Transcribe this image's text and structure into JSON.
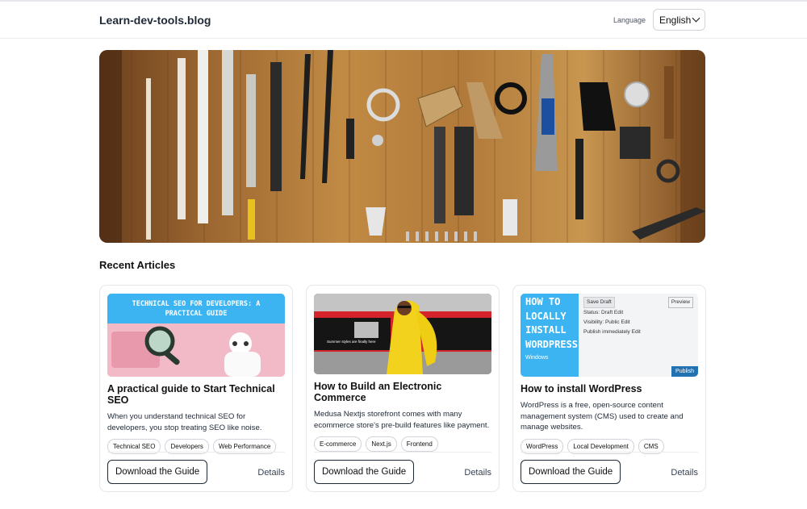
{
  "header": {
    "brand": "Learn-dev-tools.blog",
    "language_label": "Language",
    "language_value": "English"
  },
  "section_title": "Recent Articles",
  "articles": [
    {
      "image_text": "TECHNICAL SEO FOR DEVELOPERS: A PRACTICAL GUIDE",
      "title": "A practical guide to Start Technical SEO",
      "description": "When you understand technical SEO for developers, you stop treating SEO like noise.",
      "tags": [
        "Technical SEO",
        "Developers",
        "Web Performance"
      ],
      "button": "Download the Guide",
      "details": "Details"
    },
    {
      "image_text": "Summer styles are finally here",
      "title": "How to Build an Electronic Commerce",
      "description": "Medusa Nextjs storefront comes with many ecommerce store's pre-build features like payment.",
      "tags": [
        "E-commerce",
        "Next.js",
        "Frontend"
      ],
      "button": "Download the Guide",
      "details": "Details"
    },
    {
      "image_text": "HOW TO LOCALLY INSTALL WORDPRESS",
      "image_subtext": "Windows",
      "image_screen": [
        "Save Draft",
        "Status: Draft Edit",
        "Visibility: Public Edit",
        "Publish immediately Edit",
        "Preview",
        "Publish"
      ],
      "title": "How to install WordPress",
      "description": "WordPress is a free, open-source content management system (CMS) used to create and manage websites.",
      "tags": [
        "WordPress",
        "Local Development",
        "CMS"
      ],
      "button": "Download the Guide",
      "details": "Details"
    }
  ],
  "colors": {
    "accent_blue": "#3db4f2",
    "wood": "#b27a3a"
  }
}
